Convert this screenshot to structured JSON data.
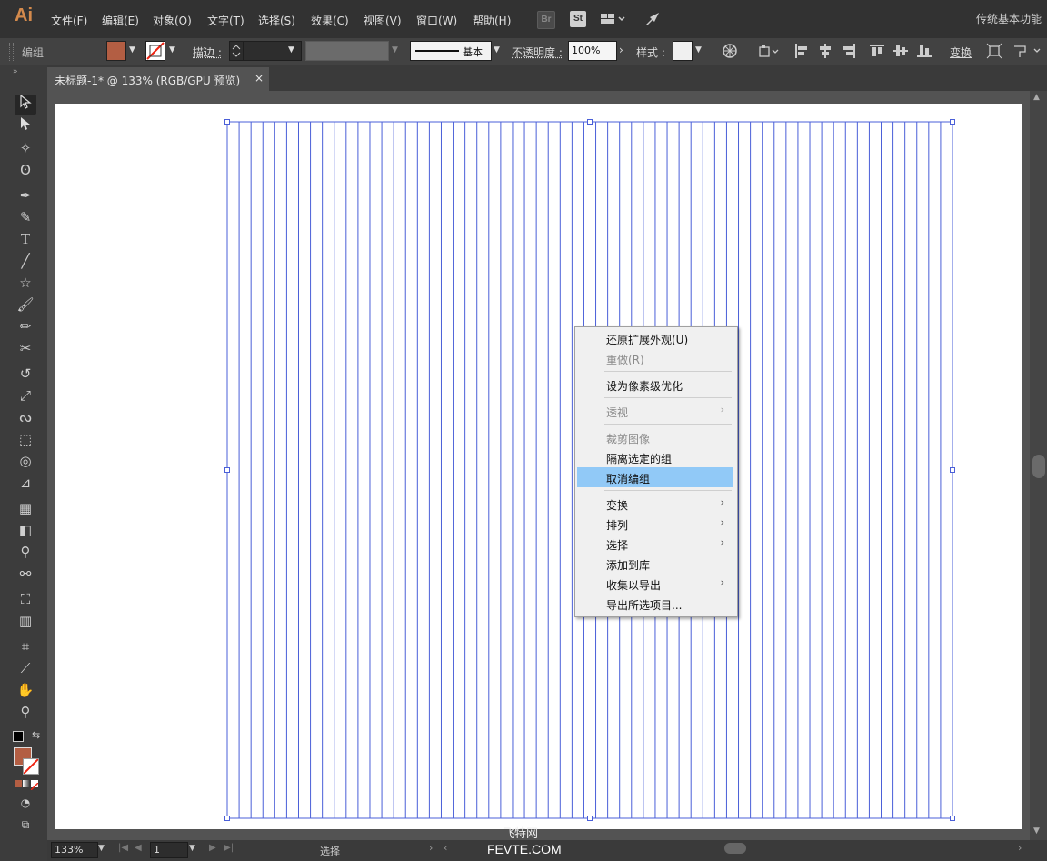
{
  "app": {
    "logo": "Ai",
    "workspace": "传统基本功能"
  },
  "menubar": {
    "items": [
      "文件(F)",
      "编辑(E)",
      "对象(O)",
      "文字(T)",
      "选择(S)",
      "效果(C)",
      "视图(V)",
      "窗口(W)",
      "帮助(H)"
    ],
    "icons": {
      "bridge": "Br",
      "stock": "St"
    }
  },
  "controlbar": {
    "group_label": "编组",
    "stroke_label": "描边 :",
    "stroke_style": "基本",
    "opacity_label": "不透明度 :",
    "opacity_value": "100%",
    "style_label": "样式 :",
    "transform_label": "变换",
    "fill_color": "#b35e43"
  },
  "document": {
    "tab_title": "未标题-1* @ 133% (RGB/GPU 预览)",
    "close": "×"
  },
  "canvas": {
    "line_color": "#4a5fd8",
    "vertical_line_count": 62
  },
  "context_menu": {
    "items": [
      {
        "label": "还原扩展外观(U)",
        "disabled": false,
        "submenu": false
      },
      {
        "label": "重做(R)",
        "disabled": true,
        "submenu": false
      },
      {
        "label": "设为像素级优化",
        "disabled": false,
        "submenu": false
      },
      {
        "label": "透视",
        "disabled": true,
        "submenu": true
      },
      {
        "label": "裁剪图像",
        "disabled": true,
        "submenu": false
      },
      {
        "label": "隔离选定的组",
        "disabled": false,
        "submenu": false
      },
      {
        "label": "取消编组",
        "disabled": false,
        "submenu": false,
        "highlighted": true
      },
      {
        "label": "变换",
        "disabled": false,
        "submenu": true
      },
      {
        "label": "排列",
        "disabled": false,
        "submenu": true
      },
      {
        "label": "选择",
        "disabled": false,
        "submenu": true
      },
      {
        "label": "添加到库",
        "disabled": false,
        "submenu": false
      },
      {
        "label": "收集以导出",
        "disabled": false,
        "submenu": true
      },
      {
        "label": "导出所选项目...",
        "disabled": false,
        "submenu": false
      }
    ]
  },
  "statusbar": {
    "zoom": "133%",
    "artboard_num": "1",
    "status": "选择"
  },
  "watermark": {
    "line1": "飞特网",
    "line2": "FEVTE.COM"
  }
}
